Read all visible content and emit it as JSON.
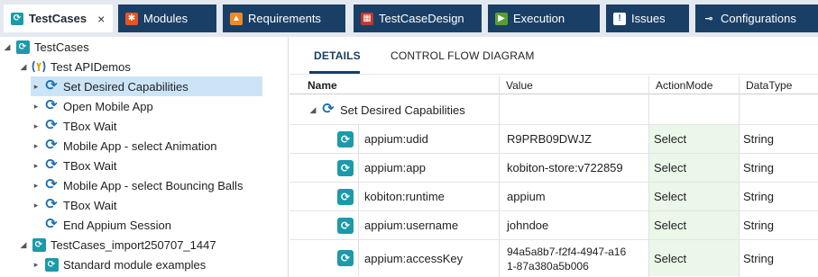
{
  "tabs": [
    {
      "label": "TestCases",
      "close": "×",
      "icon": "testcases-icon",
      "color": "#1b9aaa"
    },
    {
      "label": "Modules",
      "icon": "modules-icon",
      "color": "#e8541e"
    },
    {
      "label": "Requirements",
      "icon": "requirements-icon",
      "color": "#f08a24"
    },
    {
      "label": "TestCaseDesign",
      "icon": "testcasedesign-icon",
      "color": "#c0392b"
    },
    {
      "label": "Execution",
      "icon": "execution-icon",
      "color": "#5a9e2f"
    },
    {
      "label": "Issues",
      "icon": "issues-icon",
      "color": "#1f5fa0"
    },
    {
      "label": "Configurations",
      "icon": "configurations-icon",
      "color": "#ffffff"
    }
  ],
  "tree": {
    "root": "TestCases",
    "testcase": "Test APIDemos",
    "steps": [
      "Set Desired Capabilities",
      "Open Mobile App",
      "TBox Wait",
      "Mobile App - select Animation",
      "TBox Wait",
      "Mobile App - select Bouncing Balls",
      "TBox Wait",
      "End Appium Session"
    ],
    "folder2": "TestCases_import250707_1447",
    "folder3": "Standard module examples"
  },
  "details": {
    "tabs": [
      "DETAILS",
      "CONTROL FLOW DIAGRAM"
    ],
    "columns": [
      "Name",
      "Value",
      "ActionMode",
      "DataType"
    ],
    "group": "Set Desired Capabilities",
    "rows": [
      {
        "name": "appium:udid",
        "value": "R9PRB09DWJZ",
        "action": "Select",
        "type": "String"
      },
      {
        "name": "appium:app",
        "value": "kobiton-store:v722859",
        "action": "Select",
        "type": "String"
      },
      {
        "name": "kobiton:runtime",
        "value": "appium",
        "action": "Select",
        "type": "String"
      },
      {
        "name": "appium:username",
        "value": "johndoe",
        "action": "Select",
        "type": "String"
      },
      {
        "name": "appium:accessKey",
        "value": "94a5a8b7-f2f4-4947-a16",
        "value2": "1-87a380a5b006",
        "action": "Select",
        "type": "String"
      }
    ]
  },
  "colors": {
    "tab_bar": "#1a3f66",
    "selection": "#cce4f7",
    "actionmode_cell": "#eaf7e9",
    "testcase_icon": "#1b9aaa"
  }
}
